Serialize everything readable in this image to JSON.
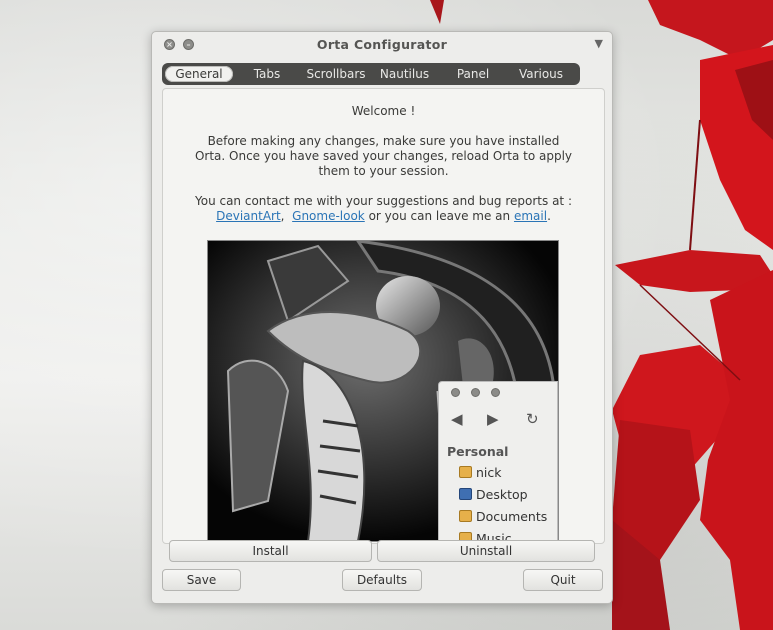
{
  "window": {
    "title": "Orta Configurator",
    "close_icon": "close-icon",
    "minimize_icon": "minimize-icon",
    "menu_icon": "triangle-down-icon"
  },
  "tabs": [
    {
      "label": "General",
      "active": true
    },
    {
      "label": "Tabs",
      "active": false
    },
    {
      "label": "Scrollbars",
      "active": false
    },
    {
      "label": "Nautilus",
      "active": false
    },
    {
      "label": "Panel",
      "active": false
    },
    {
      "label": "Various",
      "active": false
    }
  ],
  "welcome": {
    "heading": "Welcome !",
    "line1": "Before making any changes, make sure you have installed",
    "line2": "Orta. Once you have saved your changes, reload Orta to apply",
    "line3": "them to your session.",
    "contact": "You can contact me with your suggestions and bug reports at :",
    "link_deviantart": "DeviantArt",
    "sep1": ",",
    "link_gnomelook": "Gnome-look",
    "mid_text": "or you can leave me an",
    "link_email": "email",
    "end": "."
  },
  "preview": {
    "places_heading": "Personal",
    "places": [
      {
        "label": "nick",
        "icon": "home-folder-icon"
      },
      {
        "label": "Desktop",
        "icon": "desktop-icon"
      },
      {
        "label": "Documents",
        "icon": "documents-folder-icon"
      },
      {
        "label": "Music",
        "icon": "music-folder-icon"
      }
    ]
  },
  "actions": {
    "install": "Install",
    "uninstall": "Uninstall",
    "save": "Save",
    "defaults": "Defaults",
    "quit": "Quit"
  },
  "colors": {
    "tabbar": "#4a4a48",
    "link": "#2a74b6",
    "leaf_red": "#d3151c"
  }
}
